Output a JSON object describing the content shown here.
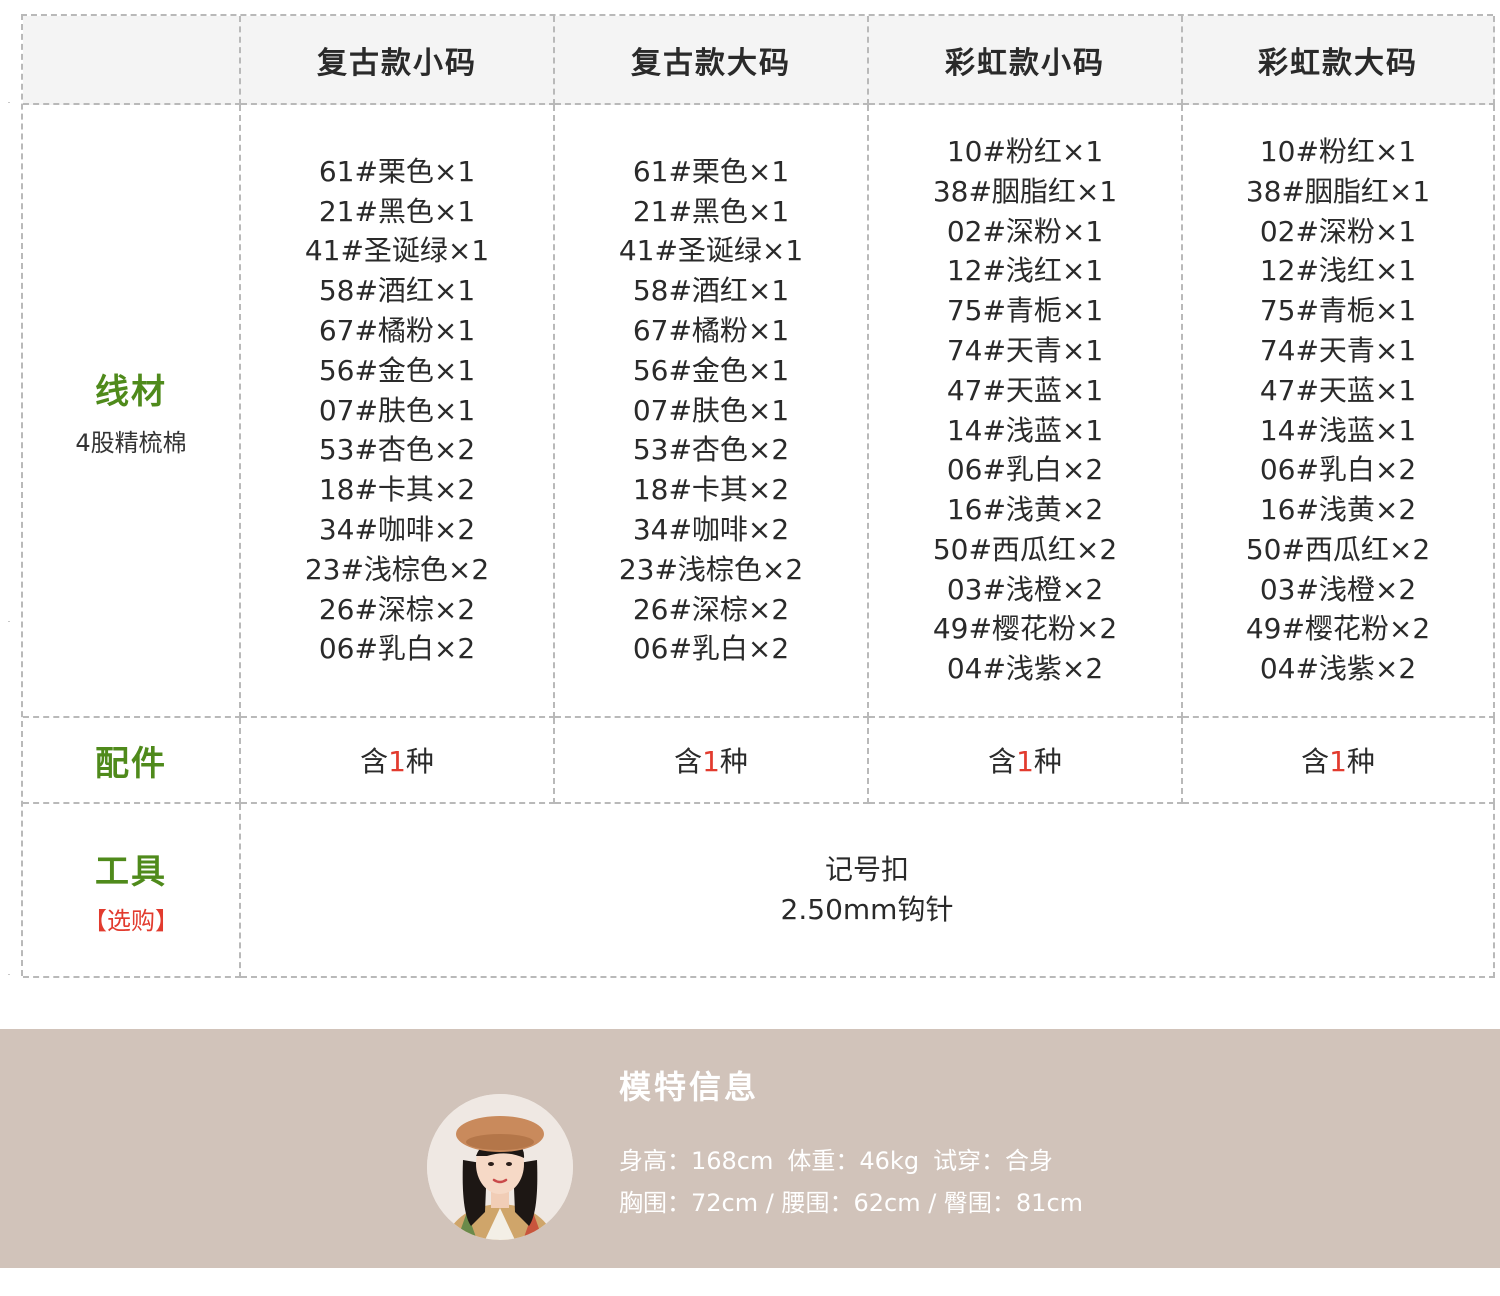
{
  "table": {
    "headers": [
      "复古款小码",
      "复古款大码",
      "彩虹款小码",
      "彩虹款大码"
    ],
    "yarn": {
      "label": "线材",
      "sub": "4股精梳棉",
      "columns": [
        [
          "61#栗色×1",
          "21#黑色×1",
          "41#圣诞绿×1",
          "58#酒红×1",
          "67#橘粉×1",
          "56#金色×1",
          "07#肤色×1",
          "53#杏色×2",
          "18#卡其×2",
          "34#咖啡×2",
          "23#浅棕色×2",
          "26#深棕×2",
          "06#乳白×2"
        ],
        [
          "61#栗色×1",
          "21#黑色×1",
          "41#圣诞绿×1",
          "58#酒红×1",
          "67#橘粉×1",
          "56#金色×1",
          "07#肤色×1",
          "53#杏色×2",
          "18#卡其×2",
          "34#咖啡×2",
          "23#浅棕色×2",
          "26#深棕×2",
          "06#乳白×2"
        ],
        [
          "10#粉红×1",
          "38#胭脂红×1",
          "02#深粉×1",
          "12#浅红×1",
          "75#青栀×1",
          "74#天青×1",
          "47#天蓝×1",
          "14#浅蓝×1",
          "06#乳白×2",
          "16#浅黄×2",
          "50#西瓜红×2",
          "03#浅橙×2",
          "49#樱花粉×2",
          "04#浅紫×2"
        ],
        [
          "10#粉红×1",
          "38#胭脂红×1",
          "02#深粉×1",
          "12#浅红×1",
          "75#青栀×1",
          "74#天青×1",
          "47#天蓝×1",
          "14#浅蓝×1",
          "06#乳白×2",
          "16#浅黄×2",
          "50#西瓜红×2",
          "03#浅橙×2",
          "49#樱花粉×2",
          "04#浅紫×2"
        ]
      ]
    },
    "accessory": {
      "label": "配件",
      "prefix": "含",
      "count": "1",
      "suffix": "种"
    },
    "tools": {
      "label": "工具",
      "sub": "【选购】",
      "lines": [
        "记号扣",
        "2.50mm钩针"
      ]
    }
  },
  "model": {
    "title": "模特信息",
    "height": "身高：168cm",
    "weight": "体重：46kg",
    "fit": "试穿：合身",
    "measurements": "胸围：72cm / 腰围：62cm / 臀围：81cm"
  },
  "colors": {
    "label_green": "#4f8a1b",
    "accent_red": "#e23b2e",
    "band": "#d1c3ba",
    "header_bg": "#f4f4f4"
  }
}
